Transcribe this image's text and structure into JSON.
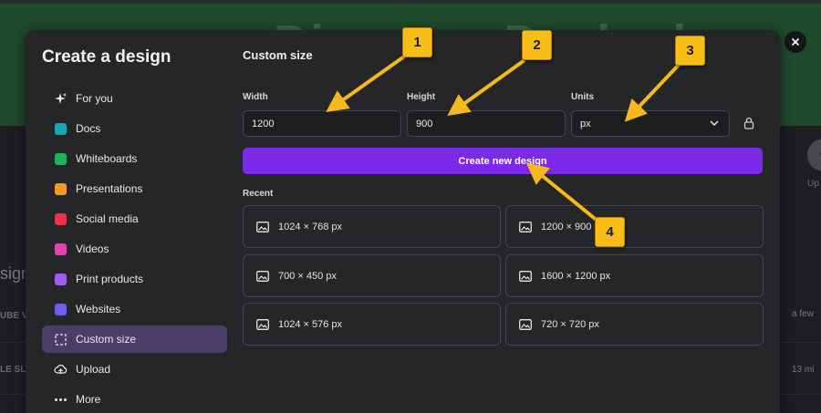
{
  "background": {
    "banner_text": "Discover Dashed",
    "left_heading": "sign",
    "left_rows": [
      "UBE VI",
      "LE SLI"
    ],
    "right_label": "Up",
    "right_times": [
      "a few",
      "13 mi"
    ]
  },
  "sidebar": {
    "title": "Create a design",
    "items": [
      {
        "label": "For you",
        "icon": "sparkle-icon"
      },
      {
        "label": "Docs",
        "icon": "docs-icon"
      },
      {
        "label": "Whiteboards",
        "icon": "whiteboards-icon"
      },
      {
        "label": "Presentations",
        "icon": "presentations-icon"
      },
      {
        "label": "Social media",
        "icon": "social-media-icon"
      },
      {
        "label": "Videos",
        "icon": "videos-icon"
      },
      {
        "label": "Print products",
        "icon": "print-products-icon"
      },
      {
        "label": "Websites",
        "icon": "websites-icon"
      },
      {
        "label": "Custom size",
        "icon": "custom-size-icon",
        "active": true
      },
      {
        "label": "Upload",
        "icon": "upload-cloud-icon"
      },
      {
        "label": "More",
        "icon": "more-dots-icon"
      }
    ]
  },
  "custom_size": {
    "title": "Custom size",
    "width_label": "Width",
    "width_value": "1200",
    "height_label": "Height",
    "height_value": "900",
    "units_label": "Units",
    "units_value": "px",
    "create_button": "Create new design",
    "recent_label": "Recent",
    "recent": [
      "1024 × 768 px",
      "1200 × 900",
      "700 × 450 px",
      "1600 × 1200 px",
      "1024 × 576 px",
      "720 × 720 px"
    ]
  },
  "callouts": [
    "1",
    "2",
    "3",
    "4"
  ],
  "colors": {
    "accent": "#7d2ae8",
    "callout": "#f8bd17",
    "active_item": "#4a3d67"
  }
}
